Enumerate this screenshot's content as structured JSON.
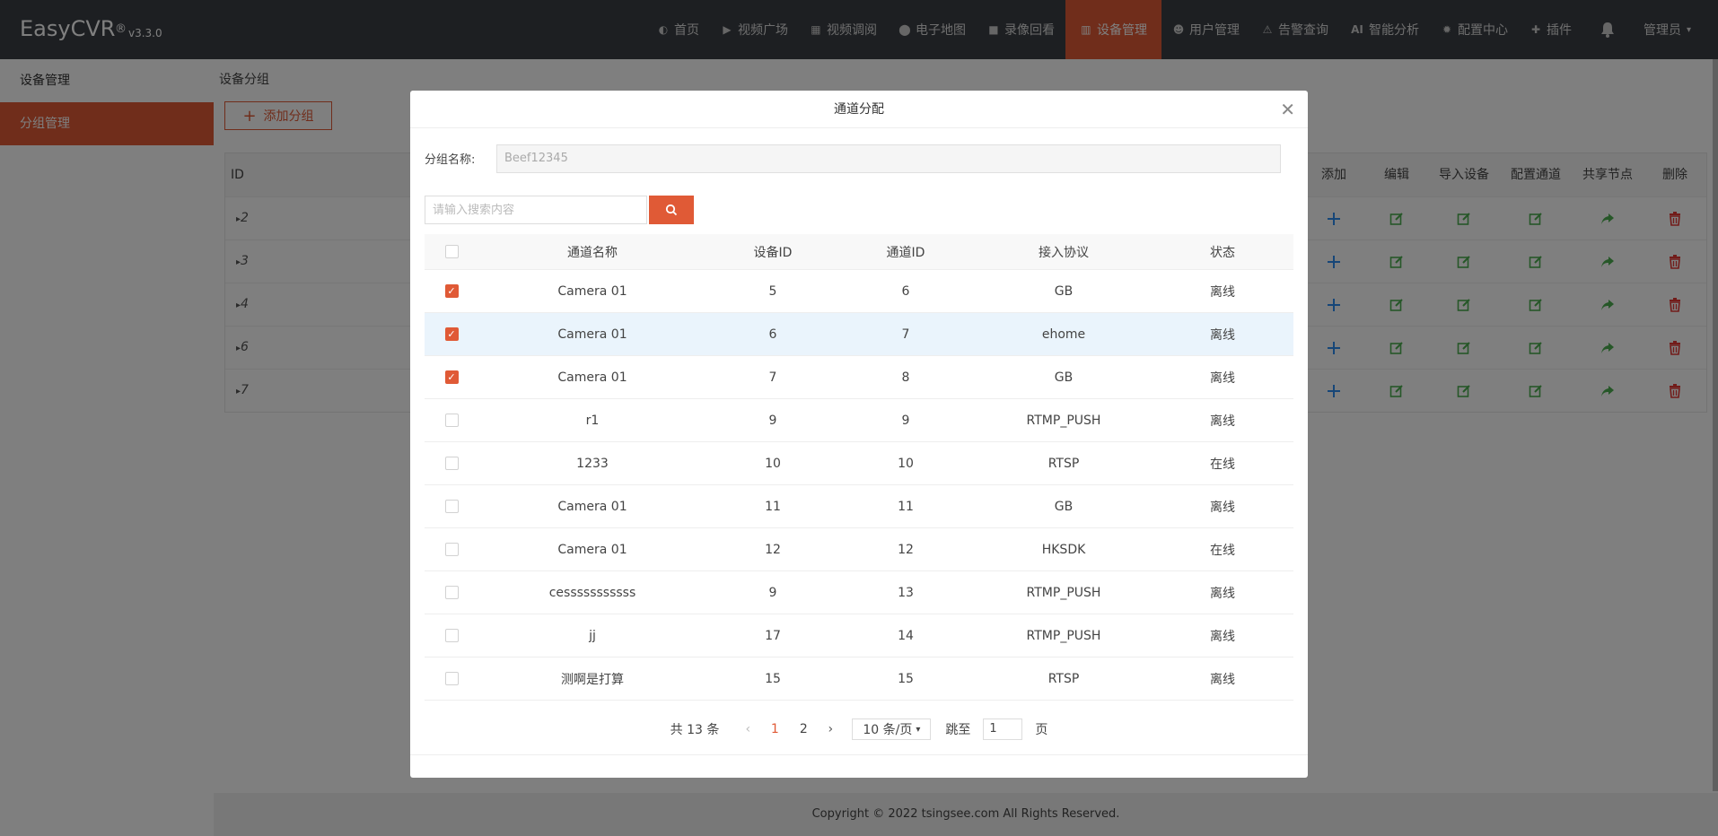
{
  "header": {
    "brand": "EasyCVR",
    "brand_reg": "®",
    "version": "v3.3.0",
    "nav": [
      {
        "icon": "dashboard-icon",
        "glyph": "◐",
        "label": "首页"
      },
      {
        "icon": "play-circle-icon",
        "glyph": "▶",
        "label": "视频广场"
      },
      {
        "icon": "grid-icon",
        "glyph": "▦",
        "label": "视频调阅"
      },
      {
        "icon": "map-pin-icon",
        "glyph": "⬤",
        "label": "电子地图"
      },
      {
        "icon": "video-camera-icon",
        "glyph": "■",
        "label": "录像回看"
      },
      {
        "icon": "device-icon",
        "glyph": "▥",
        "label": "设备管理"
      },
      {
        "icon": "user-icon",
        "glyph": "☻",
        "label": "用户管理"
      },
      {
        "icon": "alarm-icon",
        "glyph": "⚠",
        "label": "告警查询"
      },
      {
        "icon": "ai-icon",
        "glyph": "AI",
        "label": "智能分析"
      },
      {
        "icon": "gear-icon",
        "glyph": "✹",
        "label": "配置中心"
      },
      {
        "icon": "puzzle-icon",
        "glyph": "✚",
        "label": "插件"
      }
    ],
    "active_nav": "设备管理",
    "user": "管理员"
  },
  "sidebar": {
    "items": [
      {
        "label": "设备管理"
      },
      {
        "label": "分组管理"
      }
    ]
  },
  "main": {
    "breadcrumb": "设备分组",
    "add_group_label": "添加分组",
    "table": {
      "id_header": "ID",
      "op_headers": [
        "添加",
        "编辑",
        "导入设备",
        "配置通道",
        "共享节点",
        "删除"
      ],
      "rows": [
        "2",
        "3",
        "4",
        "6",
        "7"
      ]
    },
    "footer": "Copyright © 2022 tsingsee.com All Rights Reserved."
  },
  "modal": {
    "title": "通道分配",
    "group_name_label": "分组名称:",
    "group_name_value": "Beef12345",
    "search_placeholder": "请输入搜索内容",
    "columns": [
      "通道名称",
      "设备ID",
      "通道ID",
      "接入协议",
      "状态"
    ],
    "rows": [
      {
        "checked": true,
        "name": "Camera 01",
        "device_id": "5",
        "channel_id": "6",
        "protocol": "GB",
        "status": "离线"
      },
      {
        "checked": true,
        "name": "Camera 01",
        "device_id": "6",
        "channel_id": "7",
        "protocol": "ehome",
        "status": "离线"
      },
      {
        "checked": true,
        "name": "Camera 01",
        "device_id": "7",
        "channel_id": "8",
        "protocol": "GB",
        "status": "离线"
      },
      {
        "checked": false,
        "name": "r1",
        "device_id": "9",
        "channel_id": "9",
        "protocol": "RTMP_PUSH",
        "status": "离线"
      },
      {
        "checked": false,
        "name": "1233",
        "device_id": "10",
        "channel_id": "10",
        "protocol": "RTSP",
        "status": "在线"
      },
      {
        "checked": false,
        "name": "Camera 01",
        "device_id": "11",
        "channel_id": "11",
        "protocol": "GB",
        "status": "离线"
      },
      {
        "checked": false,
        "name": "Camera 01",
        "device_id": "12",
        "channel_id": "12",
        "protocol": "HKSDK",
        "status": "在线"
      },
      {
        "checked": false,
        "name": "cesssssssssss",
        "device_id": "9",
        "channel_id": "13",
        "protocol": "RTMP_PUSH",
        "status": "离线"
      },
      {
        "checked": false,
        "name": "jj",
        "device_id": "17",
        "channel_id": "14",
        "protocol": "RTMP_PUSH",
        "status": "离线"
      },
      {
        "checked": false,
        "name": "测啊是打算",
        "device_id": "15",
        "channel_id": "15",
        "protocol": "RTSP",
        "status": "离线"
      }
    ],
    "pager": {
      "total": "共 13 条",
      "pages": [
        "1",
        "2"
      ],
      "current": "1",
      "page_size": "10 条/页",
      "jump_label": "跳至",
      "jump_value": "1",
      "page_unit": "页"
    }
  },
  "colors": {
    "accent": "#e05a36",
    "header_bg": "#3b3f45",
    "add_icon": "#2d8cf0",
    "edit_icon": "#4caf50",
    "delete_icon": "#e53935"
  }
}
